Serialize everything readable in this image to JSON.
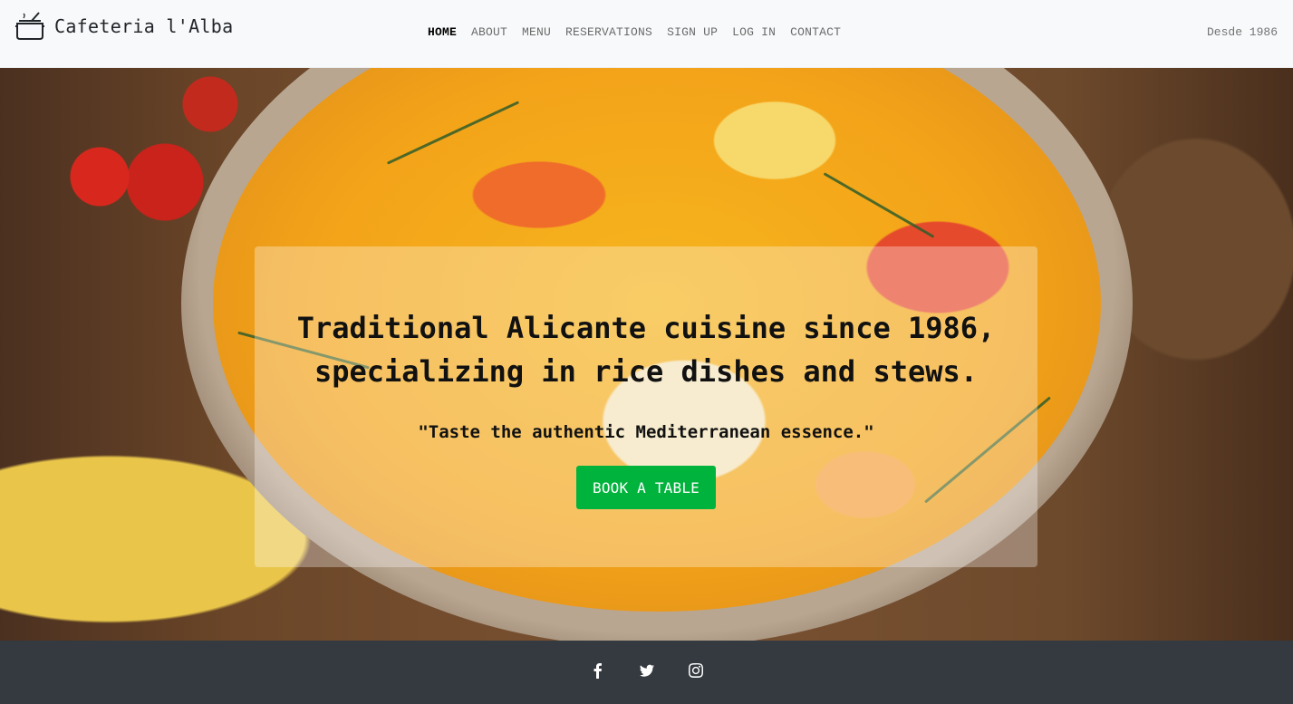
{
  "brand": {
    "name": "Cafeteria l'Alba",
    "icon": "cooking-pot-icon"
  },
  "nav": {
    "items": [
      {
        "label": "HOME",
        "active": true
      },
      {
        "label": "ABOUT",
        "active": false
      },
      {
        "label": "MENU",
        "active": false
      },
      {
        "label": "RESERVATIONS",
        "active": false
      },
      {
        "label": "SIGN UP",
        "active": false
      },
      {
        "label": "LOG IN",
        "active": false
      },
      {
        "label": "CONTACT",
        "active": false
      }
    ],
    "since": "Desde 1986"
  },
  "hero": {
    "headline": "Traditional Alicante cuisine since 1986, specializing in rice dishes and stews.",
    "tagline": "\"Taste the authentic Mediterranean essence.\"",
    "cta_label": "BOOK A TABLE",
    "image": "paella-stew-pot-photo"
  },
  "footer": {
    "social": [
      "facebook-icon",
      "twitter-icon",
      "instagram-icon"
    ]
  },
  "colors": {
    "navbar_bg": "#f8f9fa",
    "cta_green": "#00b33c",
    "footer_bg": "#343a40"
  }
}
